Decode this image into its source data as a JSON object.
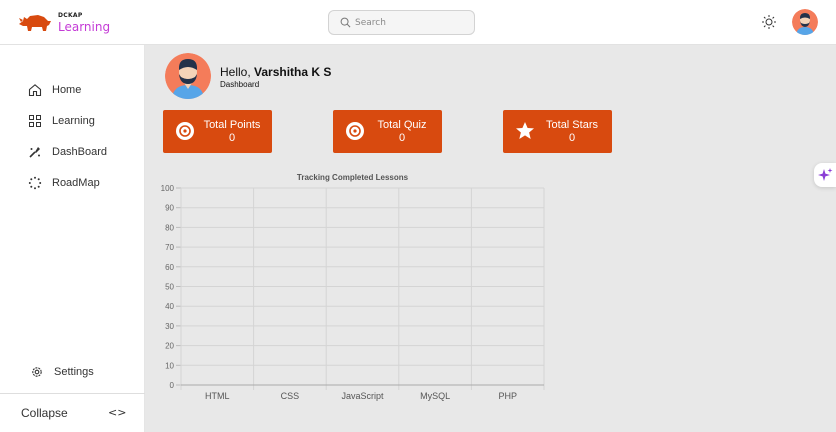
{
  "header": {
    "brand_top": "DCKAP",
    "brand_main": "Learning",
    "search_placeholder": "Search"
  },
  "sidebar": {
    "items": [
      {
        "label": "Home",
        "icon": "home-icon"
      },
      {
        "label": "Learning",
        "icon": "grid-icon"
      },
      {
        "label": "DashBoard",
        "icon": "dashboard-icon"
      },
      {
        "label": "RoadMap",
        "icon": "roadmap-icon"
      }
    ],
    "settings_label": "Settings",
    "collapse_label": "Collapse",
    "collapse_icon": "<>"
  },
  "main": {
    "greeting_prefix": "Hello, ",
    "user_name": "Varshitha K S",
    "subtitle": "Dashboard",
    "stats": [
      {
        "title": "Total Points",
        "value": "0",
        "icon": "target-icon"
      },
      {
        "title": "Total Quiz",
        "value": "0",
        "icon": "target-icon"
      },
      {
        "title": "Total Stars",
        "value": "0",
        "icon": "star-icon"
      }
    ]
  },
  "colors": {
    "accent": "#d84a0f",
    "brand": "#c43bd6",
    "avatar_bg": "#f47c5a"
  },
  "chart_data": {
    "type": "bar",
    "title": "Tracking Completed Lessons",
    "categories": [
      "HTML",
      "CSS",
      "JavaScript",
      "MySQL",
      "PHP"
    ],
    "values": [
      0,
      0,
      0,
      0,
      0
    ],
    "ylim": [
      0,
      100
    ],
    "yticks": [
      0,
      10,
      20,
      30,
      40,
      50,
      60,
      70,
      80,
      90,
      100
    ],
    "grid": true
  }
}
